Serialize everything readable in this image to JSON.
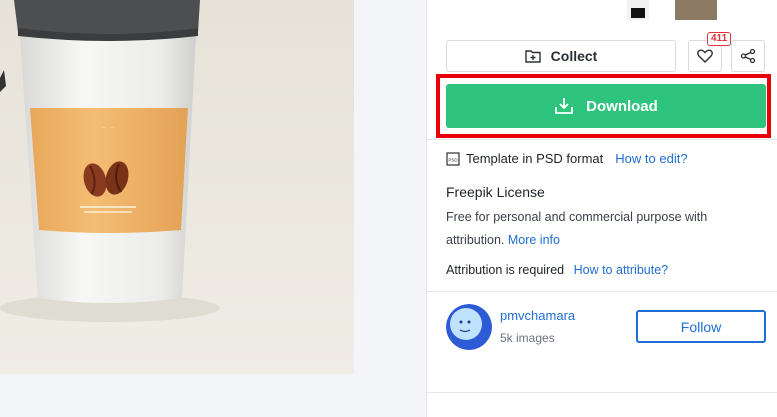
{
  "actions": {
    "collect_label": "Collect",
    "likes_count": "411",
    "download_label": "Download"
  },
  "format": {
    "text": "Template in PSD format",
    "link": "How to edit?"
  },
  "license": {
    "title": "Freepik License",
    "text": "Free for personal and commercial purpose with attribution.",
    "more_info": "More info"
  },
  "attribution": {
    "text": "Attribution is required",
    "link": "How to attribute?"
  },
  "author": {
    "name": "pmvchamara",
    "images": "5k images",
    "follow_label": "Follow"
  },
  "colors": {
    "download": "#2ec47d",
    "highlight": "#e8000b",
    "link": "#1f6ed4",
    "like_badge": "#e0323d"
  }
}
